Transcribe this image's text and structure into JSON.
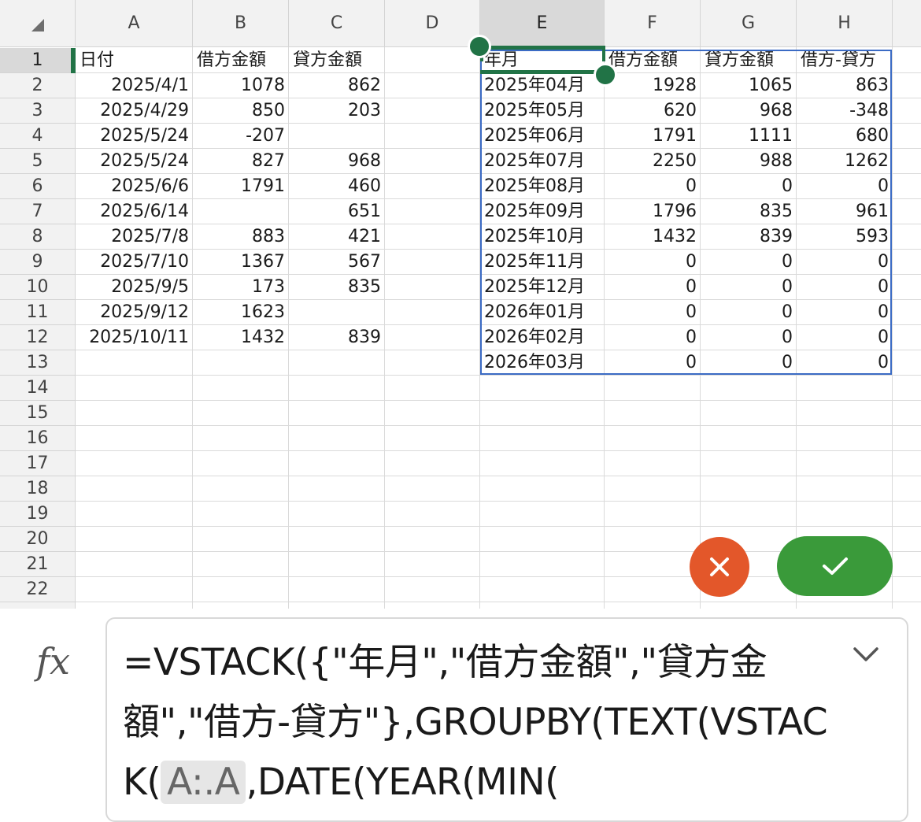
{
  "columns": [
    "A",
    "B",
    "C",
    "D",
    "E",
    "F",
    "G",
    "H"
  ],
  "selected_column": "E",
  "rows": [
    "1",
    "2",
    "3",
    "4",
    "5",
    "6",
    "7",
    "8",
    "9",
    "10",
    "11",
    "12",
    "13",
    "14",
    "15",
    "16",
    "17",
    "18",
    "19",
    "20",
    "21",
    "22"
  ],
  "selected_row": "1",
  "left_table": {
    "headers": [
      "日付",
      "借方金額",
      "貸方金額"
    ],
    "rows": [
      [
        "2025/4/1",
        "1078",
        "862"
      ],
      [
        "2025/4/29",
        "850",
        "203"
      ],
      [
        "2025/5/24",
        "-207",
        ""
      ],
      [
        "2025/5/24",
        "827",
        "968"
      ],
      [
        "2025/6/6",
        "1791",
        "460"
      ],
      [
        "2025/6/14",
        "",
        "651"
      ],
      [
        "2025/7/8",
        "883",
        "421"
      ],
      [
        "2025/7/10",
        "1367",
        "567"
      ],
      [
        "2025/9/5",
        "173",
        "835"
      ],
      [
        "2025/9/12",
        "1623",
        ""
      ],
      [
        "2025/10/11",
        "1432",
        "839"
      ]
    ]
  },
  "right_table": {
    "headers": [
      "年月",
      "借方金額",
      "貸方金額",
      "借方-貸方"
    ],
    "rows": [
      [
        "2025年04月",
        "1928",
        "1065",
        "863"
      ],
      [
        "2025年05月",
        "620",
        "968",
        "-348"
      ],
      [
        "2025年06月",
        "1791",
        "1111",
        "680"
      ],
      [
        "2025年07月",
        "2250",
        "988",
        "1262"
      ],
      [
        "2025年08月",
        "0",
        "0",
        "0"
      ],
      [
        "2025年09月",
        "1796",
        "835",
        "961"
      ],
      [
        "2025年10月",
        "1432",
        "839",
        "593"
      ],
      [
        "2025年11月",
        "0",
        "0",
        "0"
      ],
      [
        "2025年12月",
        "0",
        "0",
        "0"
      ],
      [
        "2026年01月",
        "0",
        "0",
        "0"
      ],
      [
        "2026年02月",
        "0",
        "0",
        "0"
      ],
      [
        "2026年03月",
        "0",
        "0",
        "0"
      ]
    ]
  },
  "formula_bar": {
    "fx_label": "fx",
    "formula_before": "=VSTACK({\"年月\",\"借方金額\",\"貸方金額\",\"借方-貸方\"},GROUPBY(TEXT(VSTACK(",
    "formula_ref": "A:.A",
    "formula_after": ",DATE(YEAR(MIN("
  },
  "icons": {
    "cancel": "close-icon",
    "confirm": "check-icon",
    "expand": "chevron-down-icon",
    "select_all": "select-all-triangle-icon"
  },
  "colors": {
    "selection_green": "#217346",
    "spill_blue": "#3b6bc4",
    "cancel_orange": "#e3572a",
    "confirm_green": "#3a9a3a"
  }
}
